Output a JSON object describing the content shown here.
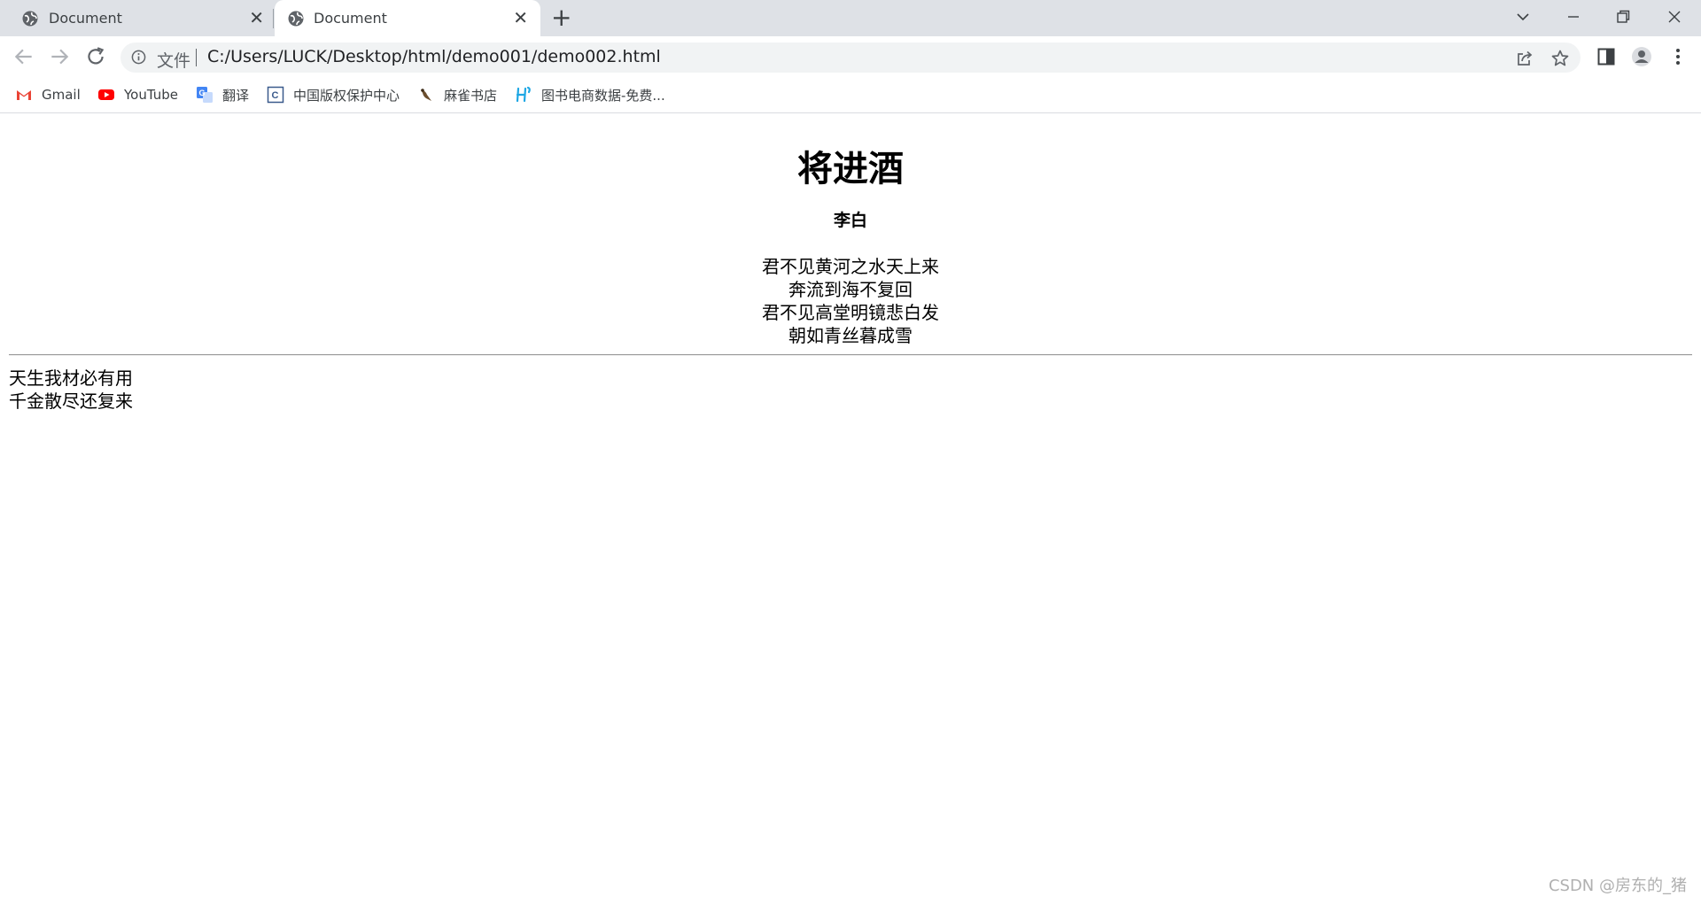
{
  "browser": {
    "tabs": [
      {
        "title": "Document",
        "active": false
      },
      {
        "title": "Document",
        "active": true
      }
    ],
    "address": {
      "security_label": "文件",
      "url": "C:/Users/LUCK/Desktop/html/demo001/demo002.html"
    },
    "bookmarks": [
      {
        "label": "Gmail",
        "icon": "gmail-icon"
      },
      {
        "label": "YouTube",
        "icon": "youtube-icon"
      },
      {
        "label": "翻译",
        "icon": "translate-icon"
      },
      {
        "label": "中国版权保护中心",
        "icon": "copyright-center-icon"
      },
      {
        "label": "麻雀书店",
        "icon": "sparrow-icon"
      },
      {
        "label": "图书电商数据-免费...",
        "icon": "book-data-icon"
      }
    ]
  },
  "page": {
    "title": "将进酒",
    "author": "李白",
    "centered_lines": [
      "君不见黄河之水天上来",
      "奔流到海不复回",
      "君不见高堂明镜悲白发",
      "朝如青丝暮成雪"
    ],
    "left_lines": [
      "天生我材必有用",
      "千金散尽还复来"
    ]
  },
  "watermark": "CSDN @房东的_猪",
  "colors": {
    "tabstrip": "#dee1e6",
    "omnibox": "#f1f3f4",
    "youtube_red": "#ff0000",
    "gmail_red": "#ea4335"
  }
}
